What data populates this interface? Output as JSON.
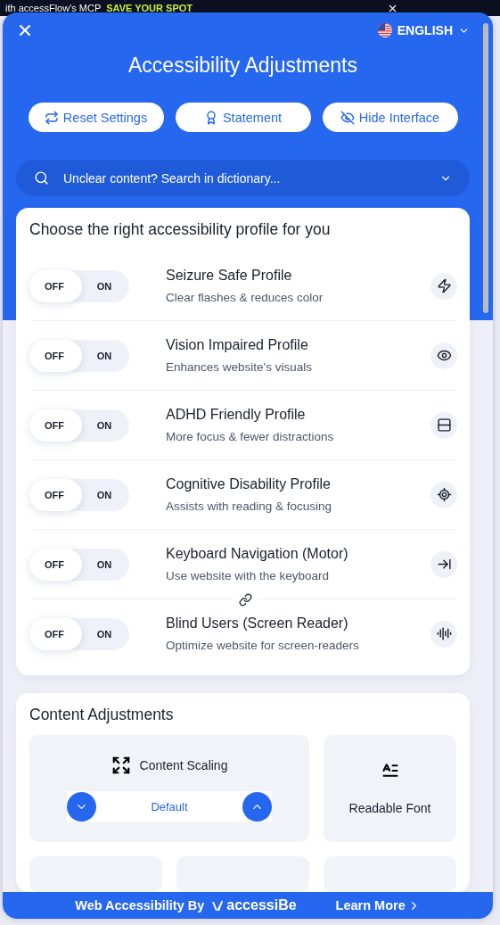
{
  "banner": {
    "text": "ith accessFlow's MCP",
    "cta": "SAVE YOUR SPOT"
  },
  "header": {
    "language": "ENGLISH",
    "title": "Accessibility Adjustments",
    "buttons": [
      {
        "kind": "reset",
        "label": "Reset Settings"
      },
      {
        "kind": "statement",
        "label": "Statement"
      },
      {
        "kind": "hide",
        "label": "Hide Interface"
      }
    ],
    "search": {
      "placeholder": "Unclear content? Search in dictionary..."
    }
  },
  "profiles": {
    "heading": "Choose the right accessibility profile for you",
    "items": [
      {
        "kind": "seizure",
        "title": "Seizure Safe Profile",
        "description": "Clear flashes & reduces color",
        "off_label": "OFF",
        "on_label": "ON",
        "on": false
      },
      {
        "kind": "vision",
        "title": "Vision Impaired Profile",
        "description": "Enhances website's visuals",
        "off_label": "OFF",
        "on_label": "ON",
        "on": false
      },
      {
        "kind": "adhd",
        "title": "ADHD Friendly Profile",
        "description": "More focus & fewer distractions",
        "off_label": "OFF",
        "on_label": "ON",
        "on": false
      },
      {
        "kind": "cognitive",
        "title": "Cognitive Disability Profile",
        "description": "Assists with reading & focusing",
        "off_label": "OFF",
        "on_label": "ON",
        "on": false
      },
      {
        "kind": "keyboard",
        "title": "Keyboard Navigation (Motor)",
        "description": "Use website with the keyboard",
        "off_label": "OFF",
        "on_label": "ON",
        "on": false
      },
      {
        "kind": "blind",
        "title": "Blind Users (Screen Reader)",
        "description": "Optimize website for screen-readers",
        "off_label": "OFF",
        "on_label": "ON",
        "on": false
      }
    ]
  },
  "content": {
    "heading": "Content Adjustments",
    "scaling": {
      "label": "Content Scaling",
      "value": "Default"
    },
    "tiles": [
      {
        "kind": "font",
        "label": "Readable Font"
      }
    ]
  },
  "footer": {
    "text": "Web Accessibility By",
    "brand": "accessiBe",
    "link": "Learn More"
  }
}
